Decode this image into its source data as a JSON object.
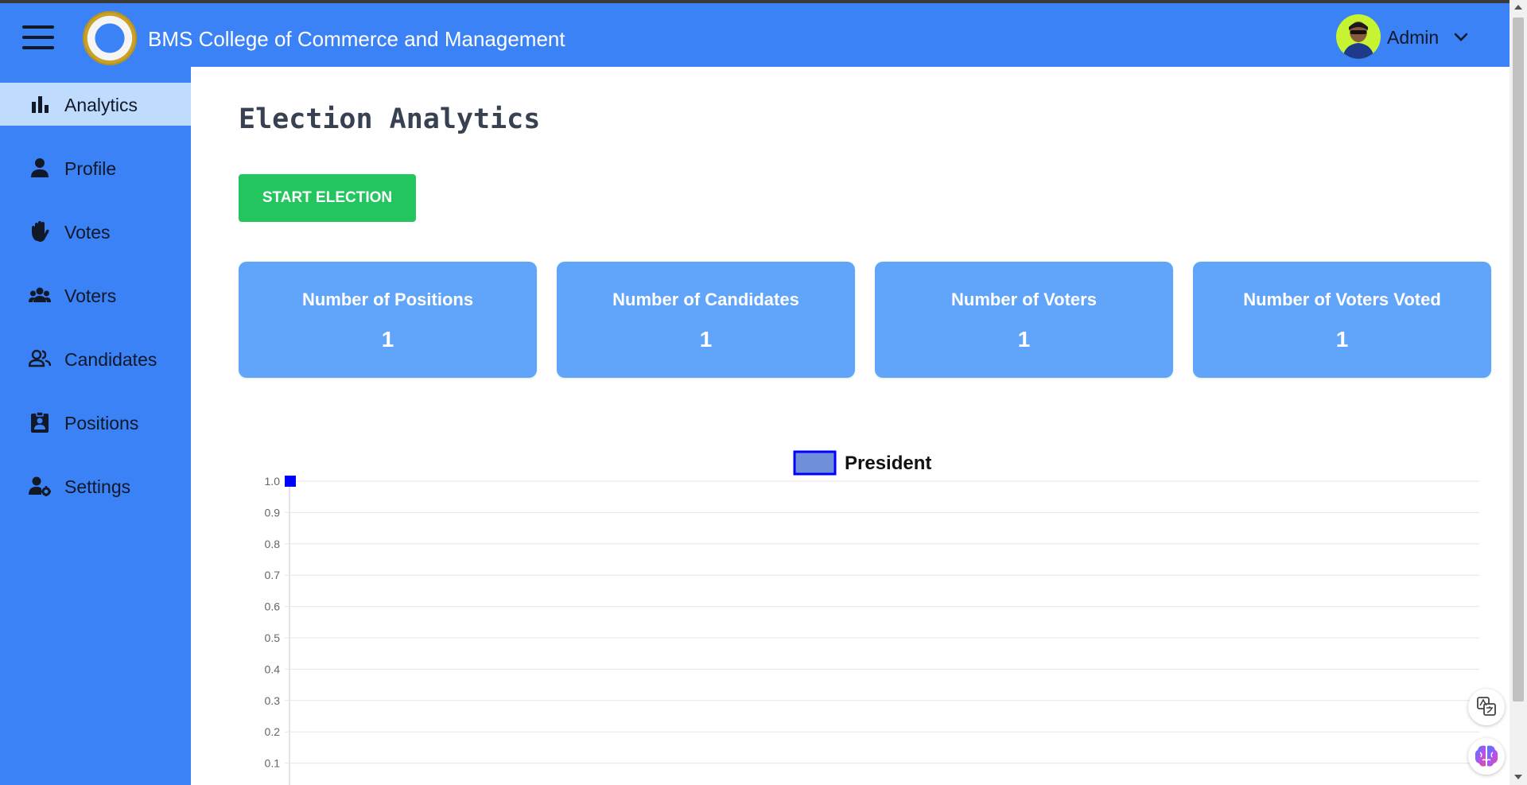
{
  "header": {
    "college_name": "BMS College of Commerce and Management",
    "user_label": "Admin"
  },
  "sidebar": {
    "items": [
      {
        "label": "Analytics",
        "icon": "bar-chart-icon",
        "active": true
      },
      {
        "label": "Profile",
        "icon": "person-icon"
      },
      {
        "label": "Votes",
        "icon": "hand-icon"
      },
      {
        "label": "Voters",
        "icon": "group-icon"
      },
      {
        "label": "Candidates",
        "icon": "people-icon"
      },
      {
        "label": "Positions",
        "icon": "badge-icon"
      },
      {
        "label": "Settings",
        "icon": "user-gear-icon"
      }
    ]
  },
  "main": {
    "title": "Election Analytics",
    "start_button": "START ELECTION",
    "cards": [
      {
        "label": "Number of Positions",
        "value": "1"
      },
      {
        "label": "Number of Candidates",
        "value": "1"
      },
      {
        "label": "Number of Voters",
        "value": "1"
      },
      {
        "label": "Number of Voters Voted",
        "value": "1"
      }
    ]
  },
  "colors": {
    "header": "#3b82f6",
    "sidebar_active": "#bfdbfe",
    "card": "#60a5fa",
    "start_button": "#22c55e",
    "series_fill": "#6f8fd8",
    "series_border": "#0000ff"
  },
  "chart_data": {
    "type": "bar",
    "categories": [
      ""
    ],
    "series": [
      {
        "name": "President",
        "values": [
          1.0
        ]
      }
    ],
    "ylim": [
      0,
      1.0
    ],
    "y_ticks": [
      "1.0",
      "0.9",
      "0.8",
      "0.7",
      "0.6",
      "0.5",
      "0.4",
      "0.3",
      "0.2",
      "0.1"
    ],
    "legend": "top-center",
    "grid": true
  }
}
